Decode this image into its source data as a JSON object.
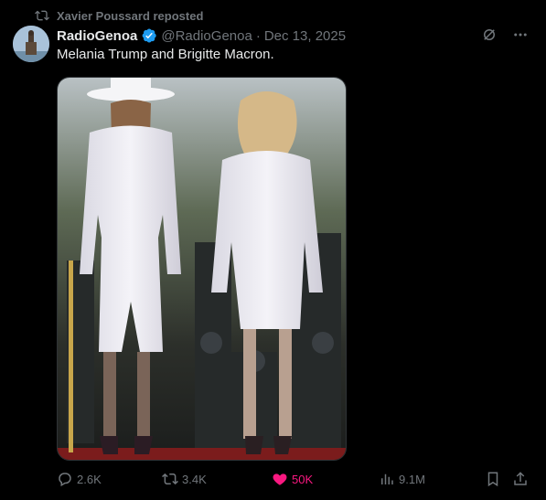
{
  "repost": {
    "text": "Xavier Poussard reposted",
    "icon": "repost-icon"
  },
  "author": {
    "name": "RadioGenoa",
    "handle": "@RadioGenoa",
    "separator": "·",
    "date": "Dec 13, 2025",
    "verified": true
  },
  "post": {
    "text": "Melania Trump and Brigitte Macron."
  },
  "actions": {
    "replies": "2.6K",
    "reposts": "3.4K",
    "likes": "50K",
    "views": "9.1M"
  },
  "colors": {
    "accent_like": "#f91880",
    "verified": "#1d9bf0",
    "muted": "#71767b"
  }
}
